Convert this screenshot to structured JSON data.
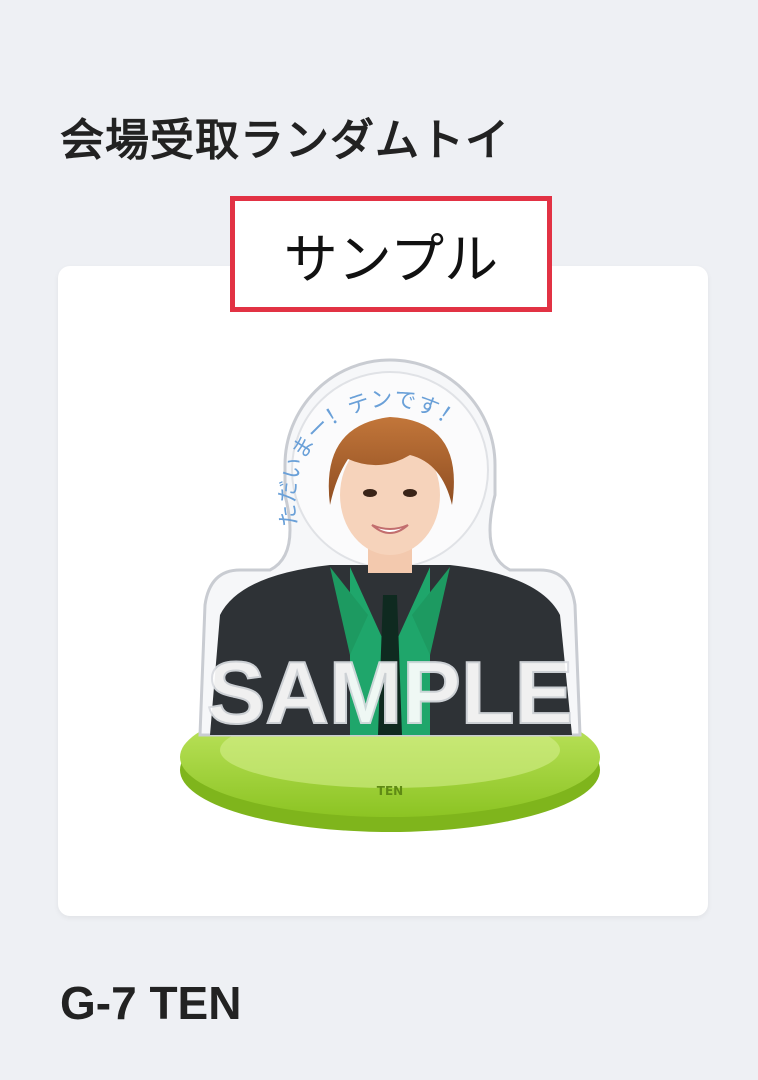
{
  "header": {
    "title": "会場受取ランダムトイ"
  },
  "sample_tag": {
    "label": "サンプル",
    "border_color": "#e23244"
  },
  "product": {
    "halo_text": "ただいまー！テンです！",
    "watermark": "SAMPLE",
    "base_label": "TEN",
    "base_color": "#9fd23a",
    "code_label": "G-7 TEN"
  }
}
